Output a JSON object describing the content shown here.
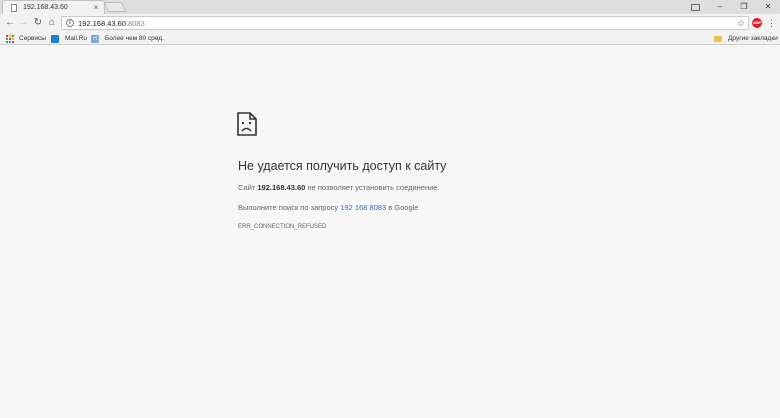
{
  "tab": {
    "title": "192.168.43.60",
    "close": "×",
    "icon": "page-icon"
  },
  "window": {
    "profile_icon": "profile-icon",
    "minimize": "–",
    "restore": "❐",
    "close": "✕"
  },
  "toolbar": {
    "back": "←",
    "forward": "→",
    "reload": "↻",
    "home": "⌂",
    "url_host": "192.168.43.60",
    "url_port": ":8083",
    "star": "☆",
    "abp_label": "ABP",
    "menu": "⋮"
  },
  "bookmarks": {
    "apps": "Сервисы",
    "mail": "Mail.Ru",
    "more": "Более чем 80 сред.",
    "other": "Другие закладки"
  },
  "error": {
    "title": "Не удается получить доступ к сайту",
    "line1_prefix": "Сайт ",
    "line1_host": "192.168.43.60",
    "line1_suffix": " не позволяет установить соединение.",
    "line2_prefix": "Выполните поиск по запросу ",
    "line2_link": "192 168 8083",
    "line2_suffix": " в Google",
    "code": "ERR_CONNECTION_REFUSED"
  },
  "colors": {
    "link": "#3367d6",
    "abp": "#d9222a",
    "background": "#f7f7f7"
  }
}
